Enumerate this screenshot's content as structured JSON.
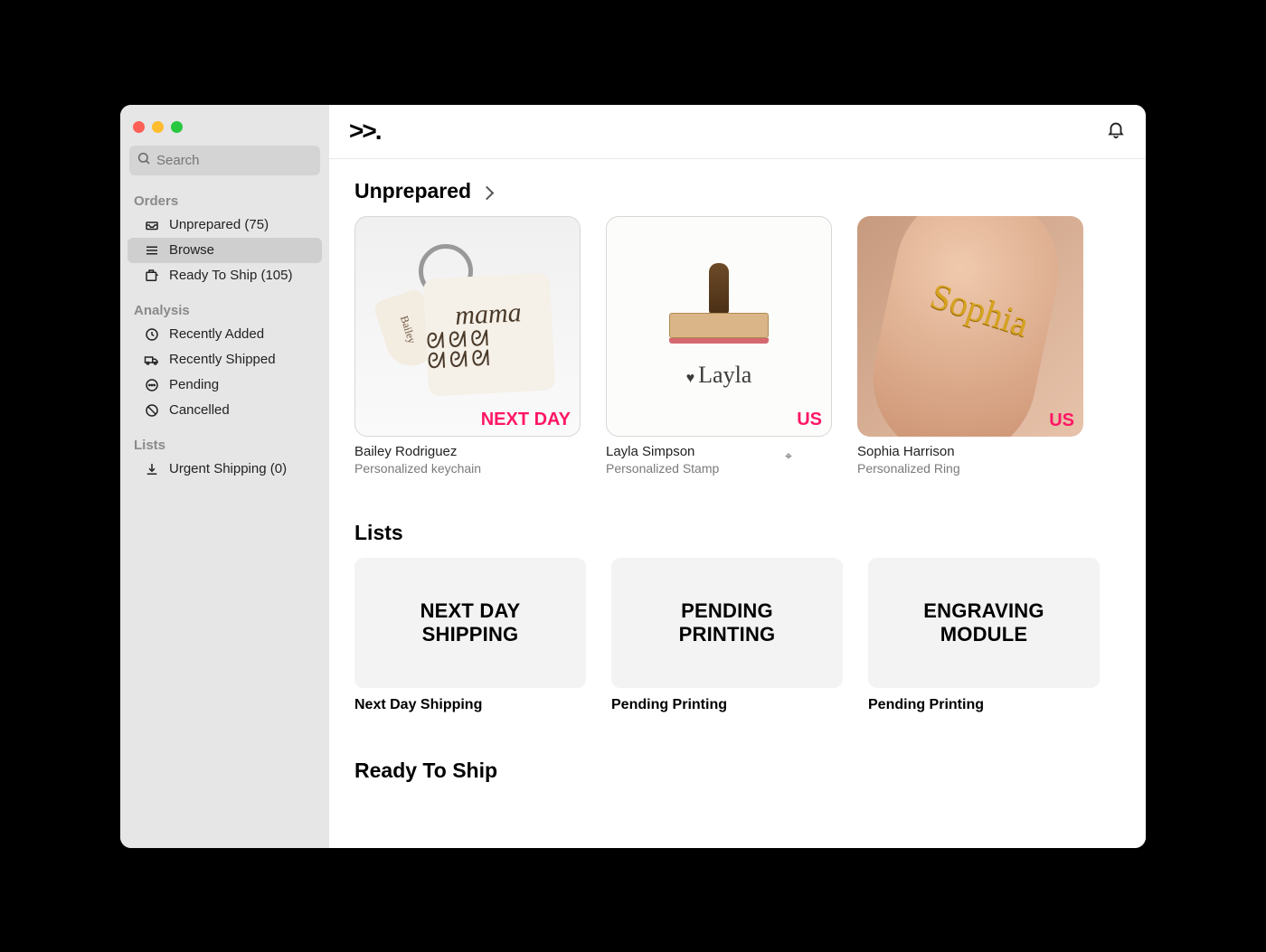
{
  "sidebar": {
    "search_placeholder": "Search",
    "sections": {
      "orders": {
        "heading": "Orders",
        "items": [
          {
            "label": "Unprepared (75)"
          },
          {
            "label": "Browse"
          },
          {
            "label": "Ready To Ship (105)"
          }
        ]
      },
      "analysis": {
        "heading": "Analysis",
        "items": [
          {
            "label": "Recently Added"
          },
          {
            "label": "Recently Shipped"
          },
          {
            "label": "Pending"
          },
          {
            "label": "Cancelled"
          }
        ]
      },
      "lists": {
        "heading": "Lists",
        "items": [
          {
            "label": "Urgent Shipping (0)"
          }
        ]
      }
    }
  },
  "topbar": {
    "logo": ">>."
  },
  "unprepared": {
    "title": "Unprepared",
    "cards": [
      {
        "badge": "NEXT DAY",
        "name": "Bailey Rodriguez",
        "desc": "Personalized keychain",
        "illustration_main": "mama",
        "illustration_spots": "ᘛᘛᘛ\nᘛᘛᘛ",
        "illustration_tag": "Bailey"
      },
      {
        "badge": "US",
        "name": "Layla Simpson",
        "desc": "Personalized Stamp",
        "illustration_script": "Layla"
      },
      {
        "badge": "US",
        "name": "Sophia Harrison",
        "desc": "Personalized Ring",
        "illustration_name": "Sophia"
      }
    ]
  },
  "lists_section": {
    "title": "Lists",
    "tiles": [
      {
        "tile_text_line1": "NEXT DAY",
        "tile_text_line2": "SHIPPING",
        "label": "Next Day Shipping"
      },
      {
        "tile_text_line1": "PENDING",
        "tile_text_line2": "PRINTING",
        "label": "Pending Printing"
      },
      {
        "tile_text_line1": "ENGRAVING",
        "tile_text_line2": "MODULE",
        "label": "Pending Printing"
      }
    ]
  },
  "ready_section": {
    "title": "Ready To Ship"
  }
}
